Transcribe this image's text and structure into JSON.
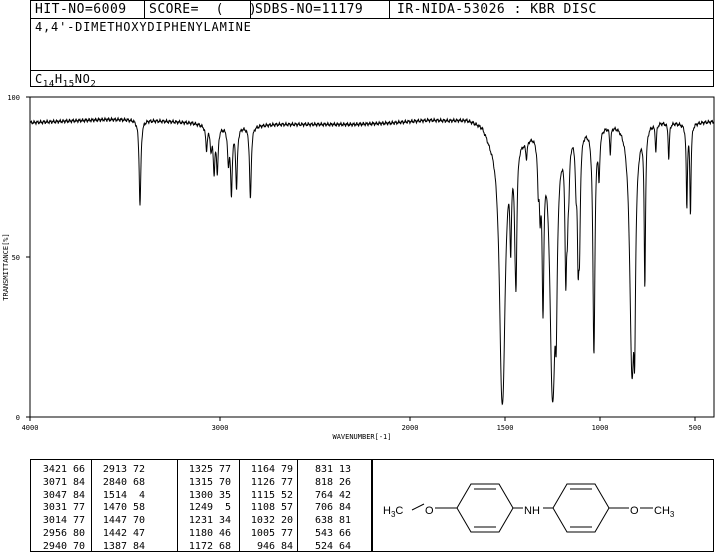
{
  "header": {
    "hit_no": "HIT-NO=6009",
    "score": "SCORE=  (   )",
    "sdbs_no": "SDBS-NO=11179",
    "source": "IR-NIDA-53026 : KBR DISC",
    "compound_name": "4,4'-DIMETHOXYDIPHENYLAMINE",
    "formula_c": "C",
    "formula_c_sub": "14",
    "formula_h": "H",
    "formula_h_sub": "15",
    "formula_n": "NO",
    "formula_o_sub": "2"
  },
  "chart_data": {
    "type": "line",
    "title": "",
    "xlabel": "WAVENUMBER[-1]",
    "ylabel": "TRANSMITTANCE[%]",
    "xlim": [
      4000,
      400
    ],
    "ylim": [
      0,
      100
    ],
    "x_ticks": [
      4000,
      3000,
      2000,
      1500,
      1000,
      500
    ],
    "x_tick_labels": [
      "4000",
      "3000",
      "2000",
      "1500",
      "1000",
      "500"
    ],
    "y_ticks": [
      0,
      50,
      100
    ],
    "y_tick_labels": [
      "0",
      "50",
      "100"
    ],
    "grid": false,
    "baseline": [
      [
        4000,
        92
      ],
      [
        3800,
        92.5
      ],
      [
        3600,
        93
      ],
      [
        3450,
        93
      ],
      [
        3300,
        92.5
      ],
      [
        3150,
        92
      ],
      [
        3050,
        91
      ],
      [
        2850,
        91
      ],
      [
        2700,
        91.5
      ],
      [
        2500,
        91.5
      ],
      [
        2300,
        91.5
      ],
      [
        2100,
        92
      ],
      [
        2000,
        92.5
      ],
      [
        1900,
        93
      ],
      [
        1800,
        93
      ],
      [
        1700,
        93.5
      ],
      [
        1620,
        92.5
      ],
      [
        1580,
        89
      ],
      [
        1400,
        89
      ],
      [
        1350,
        91
      ],
      [
        1000,
        92
      ],
      [
        900,
        93
      ],
      [
        700,
        93
      ],
      [
        560,
        92
      ],
      [
        400,
        92.5
      ]
    ],
    "peaks": [
      {
        "x": 3421,
        "y": 66
      },
      {
        "x": 3071,
        "y": 84
      },
      {
        "x": 3047,
        "y": 84
      },
      {
        "x": 3031,
        "y": 77
      },
      {
        "x": 3014,
        "y": 77
      },
      {
        "x": 2956,
        "y": 80
      },
      {
        "x": 2940,
        "y": 70
      },
      {
        "x": 2913,
        "y": 72
      },
      {
        "x": 2840,
        "y": 68
      },
      {
        "x": 1514,
        "y": 4
      },
      {
        "x": 1470,
        "y": 58
      },
      {
        "x": 1447,
        "y": 70
      },
      {
        "x": 1442,
        "y": 47
      },
      {
        "x": 1387,
        "y": 84
      },
      {
        "x": 1325,
        "y": 77
      },
      {
        "x": 1315,
        "y": 70
      },
      {
        "x": 1300,
        "y": 35
      },
      {
        "x": 1249,
        "y": 5
      },
      {
        "x": 1231,
        "y": 34
      },
      {
        "x": 1180,
        "y": 46
      },
      {
        "x": 1172,
        "y": 68
      },
      {
        "x": 1164,
        "y": 79
      },
      {
        "x": 1126,
        "y": 77
      },
      {
        "x": 1115,
        "y": 52
      },
      {
        "x": 1108,
        "y": 57
      },
      {
        "x": 1032,
        "y": 20
      },
      {
        "x": 1005,
        "y": 77
      },
      {
        "x": 946,
        "y": 84
      },
      {
        "x": 831,
        "y": 13
      },
      {
        "x": 818,
        "y": 26
      },
      {
        "x": 764,
        "y": 42
      },
      {
        "x": 706,
        "y": 84
      },
      {
        "x": 638,
        "y": 81
      },
      {
        "x": 543,
        "y": 66
      },
      {
        "x": 524,
        "y": 64
      }
    ]
  },
  "peak_table": {
    "columns": [
      [
        [
          "3421",
          "66"
        ],
        [
          "3071",
          "84"
        ],
        [
          "3047",
          "84"
        ],
        [
          "3031",
          "77"
        ],
        [
          "3014",
          "77"
        ],
        [
          "2956",
          "80"
        ],
        [
          "2940",
          "70"
        ]
      ],
      [
        [
          "2913",
          "72"
        ],
        [
          "2840",
          "68"
        ],
        [
          "1514",
          "4"
        ],
        [
          "1470",
          "58"
        ],
        [
          "1447",
          "70"
        ],
        [
          "1442",
          "47"
        ],
        [
          "1387",
          "84"
        ]
      ],
      [
        [
          "1325",
          "77"
        ],
        [
          "1315",
          "70"
        ],
        [
          "1300",
          "35"
        ],
        [
          "1249",
          "5"
        ],
        [
          "1231",
          "34"
        ],
        [
          "1180",
          "46"
        ],
        [
          "1172",
          "68"
        ]
      ],
      [
        [
          "1164",
          "79"
        ],
        [
          "1126",
          "77"
        ],
        [
          "1115",
          "52"
        ],
        [
          "1108",
          "57"
        ],
        [
          "1032",
          "20"
        ],
        [
          "1005",
          "77"
        ],
        [
          "946",
          "84"
        ]
      ],
      [
        [
          "831",
          "13"
        ],
        [
          "818",
          "26"
        ],
        [
          "764",
          "42"
        ],
        [
          "706",
          "84"
        ],
        [
          "638",
          "81"
        ],
        [
          "543",
          "66"
        ],
        [
          "524",
          "64"
        ]
      ]
    ]
  },
  "structure": {
    "left_group_main": "H",
    "left_group_sub": "3",
    "left_group_tail": "C",
    "left_oxygen": "O",
    "amine": "NH",
    "right_oxygen": "O",
    "right_group_main": "CH",
    "right_group_sub": "3"
  }
}
